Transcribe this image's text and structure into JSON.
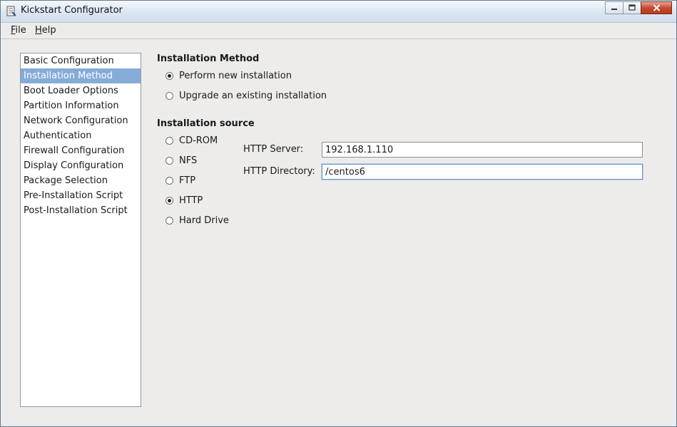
{
  "window": {
    "title": "Kickstart Configurator"
  },
  "menubar": {
    "file": {
      "mnemonic": "F",
      "rest": "ile"
    },
    "help": {
      "mnemonic": "H",
      "rest": "elp"
    }
  },
  "sidebar": {
    "items": [
      {
        "label": "Basic Configuration"
      },
      {
        "label": "Installation Method"
      },
      {
        "label": "Boot Loader Options"
      },
      {
        "label": "Partition Information"
      },
      {
        "label": "Network Configuration"
      },
      {
        "label": "Authentication"
      },
      {
        "label": "Firewall Configuration"
      },
      {
        "label": "Display Configuration"
      },
      {
        "label": "Package Selection"
      },
      {
        "label": "Pre-Installation Script"
      },
      {
        "label": "Post-Installation Script"
      }
    ],
    "selected_index": 1
  },
  "installation_method": {
    "title": "Installation Method",
    "options": [
      {
        "label": "Perform new installation",
        "checked": true
      },
      {
        "label": "Upgrade an existing installation",
        "checked": false
      }
    ]
  },
  "installation_source": {
    "title": "Installation source",
    "options": [
      {
        "label": "CD-ROM",
        "checked": false
      },
      {
        "label": "NFS",
        "checked": false
      },
      {
        "label": "FTP",
        "checked": false
      },
      {
        "label": "HTTP",
        "checked": true
      },
      {
        "label": "Hard Drive",
        "checked": false
      }
    ],
    "http_server": {
      "label": "HTTP Server:",
      "value": "192.168.1.110"
    },
    "http_directory": {
      "label": "HTTP Directory:",
      "value": "/centos6"
    }
  },
  "colors": {
    "selection": "#86abd9",
    "window_bg": "#edeceb",
    "close_button": "#c8492f"
  }
}
